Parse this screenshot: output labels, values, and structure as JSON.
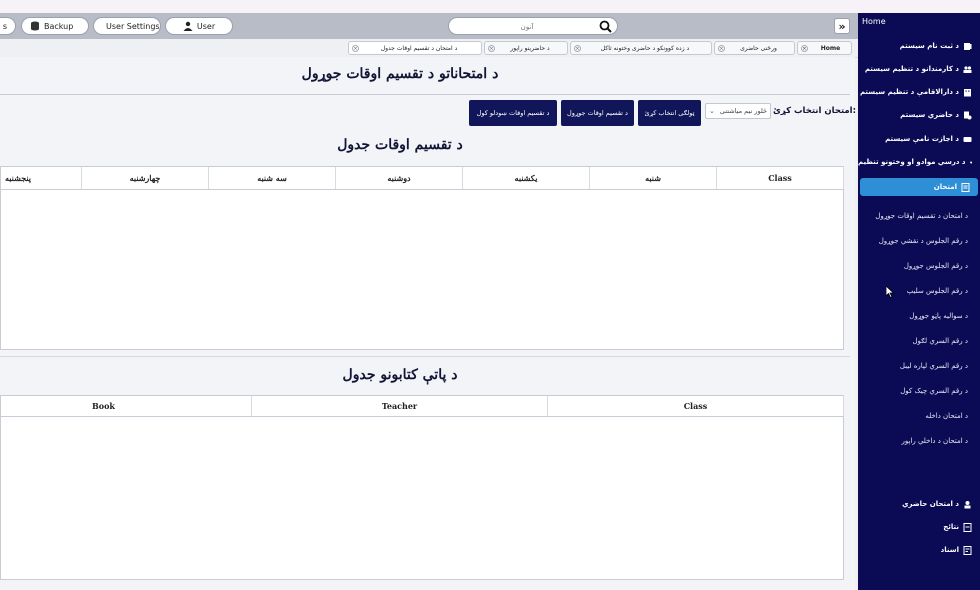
{
  "header": {
    "user_label": "User",
    "user_settings_label": "User Settings",
    "backup_label": "Backup",
    "search_placeholder": "آنون",
    "toggle_glyph": "»"
  },
  "tabs": [
    {
      "label": "Home"
    },
    {
      "label": "ورځنی حاضری"
    },
    {
      "label": "د زده کوونکو د حاضری وختونه ثاکل"
    },
    {
      "label": "د حاضرینو راپور"
    },
    {
      "label": "د امتحان د تقسیم اوقات جدول"
    }
  ],
  "main": {
    "page_title": "د امتحاناتو د تقسیم اوقات جوړول",
    "exam_select_label": "امتحان انتخاب کړئ:",
    "exam_select_value": "څلور نیم میاشتنی",
    "buttons": {
      "select_all": "ټولګی انتخاب کړئ",
      "create_schedule": "د تقسیم اوقات جوړول",
      "show_schedule": "د تقسیم اوقات ښودلو کول"
    },
    "schedule_title": "د تقسیم اوقات جدول",
    "schedule_columns": [
      "Class",
      "شنبه",
      "یکشنبه",
      "دوشنبه",
      "سه شنبه",
      "چهارشنبه",
      "پنجشنبه"
    ],
    "books_title": "د پاتې کتابونو جدول",
    "books_columns": [
      "Class",
      "Teacher",
      "Book"
    ]
  },
  "sidebar": {
    "home_label": "Home",
    "items": [
      {
        "label": "د ثبت نام سیستم",
        "icon": "registration-icon"
      },
      {
        "label": "د کارمندانو د تنظیم سیستم",
        "icon": "staff-icon"
      },
      {
        "label": "د دارالاقامې د تنظیم سیستم",
        "icon": "building-icon"
      },
      {
        "label": "د حاضري سیستم",
        "icon": "attendance-icon"
      },
      {
        "label": "د اجازت نامې سیستم",
        "icon": "permission-icon"
      },
      {
        "label": "د درسي موادو او وختونو تنظیم",
        "icon": "book-icon"
      },
      {
        "label": "امتحان",
        "icon": "exam-icon"
      }
    ],
    "exam_subitems": [
      "د امتحان د تقسیم اوقات جوړول",
      "د رقم الجلوس د نقشي جوړول",
      "د رقم الجلوس جوړول",
      "د رقم الجلوس سلیپ",
      "د سوالیه پاڼو جوړول",
      "د رقم السري لګول",
      "د رقم السري لپاره لیبل",
      "د رقم السري چیک کول",
      "د امتحان داخله",
      "د امتحان د داخلي راپور"
    ],
    "bottom_items": [
      {
        "label": "د امتحان حاضري",
        "icon": "exam-attendance-icon"
      },
      {
        "label": "نتائج",
        "icon": "results-icon"
      },
      {
        "label": "اسناد",
        "icon": "documents-icon"
      }
    ]
  }
}
